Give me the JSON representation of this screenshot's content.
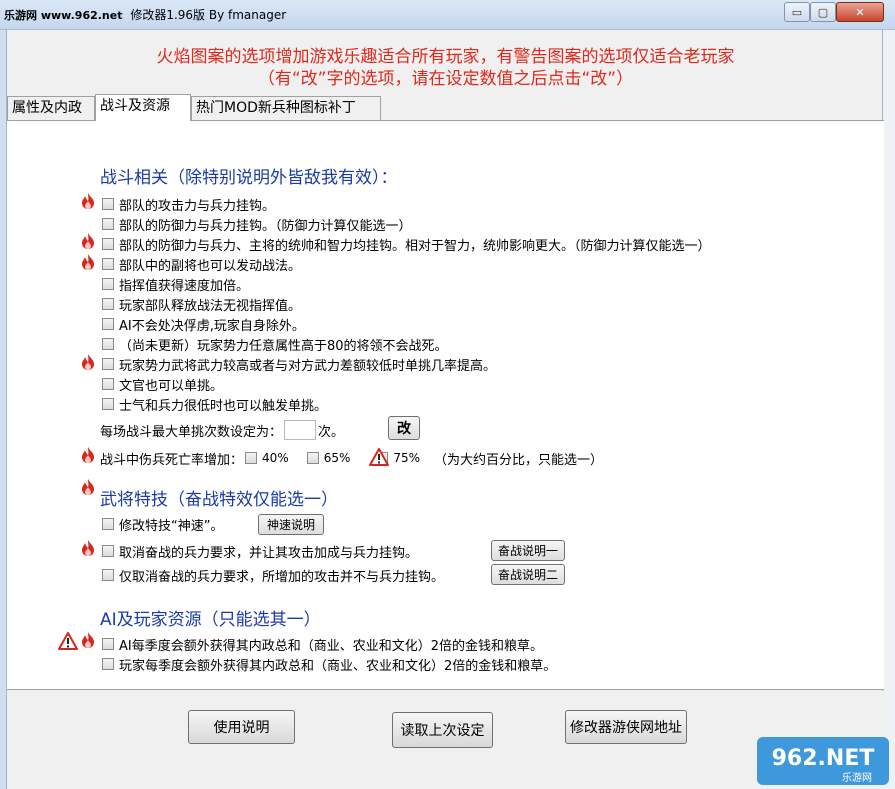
{
  "window": {
    "title_site": "乐游网 www.962.net",
    "title_app": "修改器1.96版 By fmanager",
    "min_label": "▭",
    "max_label": "▢",
    "close_label": "✕"
  },
  "notice": {
    "line1": "火焰图案的选项增加游戏乐趣适合所有玩家，有警告图案的选项仅适合老玩家",
    "line2": "（有“改”字的选项，请在设定数值之后点击“改”）"
  },
  "tabs": [
    {
      "label": "属性及内政"
    },
    {
      "label": "战斗及资源"
    },
    {
      "label": "热门MOD新兵种图标补丁"
    }
  ],
  "battle": {
    "title": "战斗相关（除特别说明外皆敌我有效）：",
    "items": [
      {
        "label": "部队的攻击力与兵力挂钩。"
      },
      {
        "label": "部队的防御力与兵力挂钩。（防御力计算仅能选一）"
      },
      {
        "label": "部队的防御力与兵力、主将的统帅和智力均挂钩。相对于智力，统帅影响更大。（防御力计算仅能选一）"
      },
      {
        "label": "部队中的副将也可以发动战法。"
      },
      {
        "label": "指挥值获得速度加倍。"
      },
      {
        "label": "玩家部队释放战法无视指挥值。"
      },
      {
        "label": "AI不会处决俘虏,玩家自身除外。"
      },
      {
        "label": "（尚未更新）玩家势力任意属性高于80的将领不会战死。"
      },
      {
        "label": "玩家势力武将武力较高或者与对方武力差额较低时单挑几率提高。"
      },
      {
        "label": "文官也可以单挑。"
      },
      {
        "label": "士气和兵力很低时也可以触发单挑。"
      }
    ],
    "duel_label": "每场战斗最大单挑次数设定为：",
    "duel_suffix": "次。",
    "duel_value": "",
    "change_button": "改",
    "death_label": "战斗中伤兵死亡率增加：",
    "death_opt1": "40%",
    "death_opt2": "65%",
    "death_opt3": "75%",
    "death_note": "（为大约百分比，只能选一）"
  },
  "skills": {
    "title": "武将特技（奋战特效仅能选一）",
    "item1": "修改特技“神速”。",
    "item1_button": "神速说明",
    "item2": "取消奋战的兵力要求，并让其攻击加成与兵力挂钩。",
    "item2_button": "奋战说明一",
    "item3": "仅取消奋战的兵力要求，所增加的攻击并不与兵力挂钩。",
    "item3_button": "奋战说明二"
  },
  "resources": {
    "title": "AI及玩家资源（只能选其一）",
    "item1": "AI每季度会额外获得其内政总和（商业、农业和文化）2倍的金钱和粮草。",
    "item2": "玩家每季度会额外获得其内政总和（商业、农业和文化）2倍的金钱和粮草。"
  },
  "footer": {
    "help_button": "使用说明",
    "load_button": "读取上次设定",
    "site_button": "修改器游侠网地址"
  },
  "watermark": {
    "text": "962.NET",
    "sub": "乐游网"
  },
  "colors": {
    "notice": "#e0281c",
    "section": "#1b3aa8",
    "fire": "#d8261c",
    "warn": "#d8261c"
  }
}
